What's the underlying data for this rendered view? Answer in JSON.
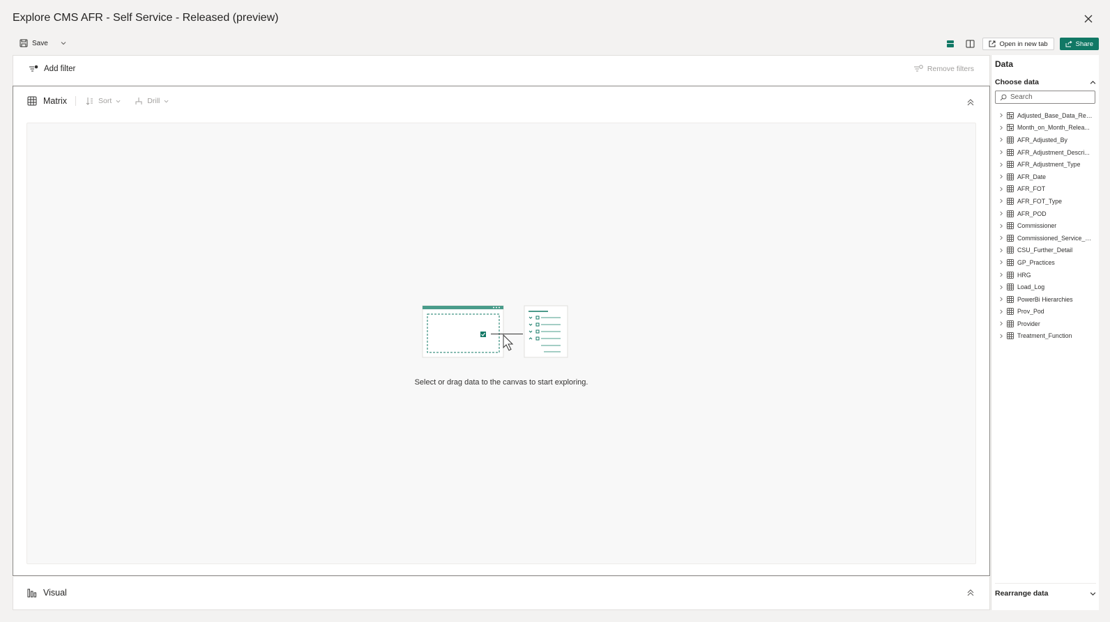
{
  "window": {
    "title": "Explore CMS AFR - Self Service - Released (preview)"
  },
  "toolbar": {
    "save_label": "Save",
    "open_new_tab_label": "Open in new tab",
    "share_label": "Share"
  },
  "filters": {
    "add_label": "Add filter",
    "remove_label": "Remove filters"
  },
  "canvas": {
    "visual_type_label": "Matrix",
    "sort_label": "Sort",
    "drill_label": "Drill",
    "empty_message": "Select or drag data to the canvas to start exploring."
  },
  "visual_section": {
    "label": "Visual"
  },
  "data_pane": {
    "title": "Data",
    "choose_label": "Choose data",
    "search_placeholder": "Search",
    "tables": [
      {
        "label": "Adjusted_Base_Data_Rel...",
        "icon": "dataset-icon"
      },
      {
        "label": "Month_on_Month_Relea...",
        "icon": "dataset-icon"
      },
      {
        "label": "AFR_Adjusted_By",
        "icon": "table-icon"
      },
      {
        "label": "AFR_Adjustment_Descri...",
        "icon": "table-icon"
      },
      {
        "label": "AFR_Adjustment_Type",
        "icon": "table-icon"
      },
      {
        "label": "AFR_Date",
        "icon": "table-icon"
      },
      {
        "label": "AFR_FOT",
        "icon": "table-icon"
      },
      {
        "label": "AFR_FOT_Type",
        "icon": "table-icon"
      },
      {
        "label": "AFR_POD",
        "icon": "table-icon"
      },
      {
        "label": "Commissioner",
        "icon": "table-icon"
      },
      {
        "label": "Commissioned_Service_C...",
        "icon": "table-icon"
      },
      {
        "label": "CSU_Further_Detail",
        "icon": "table-icon"
      },
      {
        "label": "GP_Practices",
        "icon": "table-icon"
      },
      {
        "label": "HRG",
        "icon": "table-icon"
      },
      {
        "label": "Load_Log",
        "icon": "table-icon"
      },
      {
        "label": "PowerBi Hierarchies",
        "icon": "table-icon"
      },
      {
        "label": "Prov_Pod",
        "icon": "table-icon"
      },
      {
        "label": "Provider",
        "icon": "table-icon"
      },
      {
        "label": "Treatment_Function",
        "icon": "table-icon"
      }
    ],
    "rearrange_label": "Rearrange data"
  },
  "colors": {
    "accent": "#117865",
    "border": "#8a8886"
  }
}
